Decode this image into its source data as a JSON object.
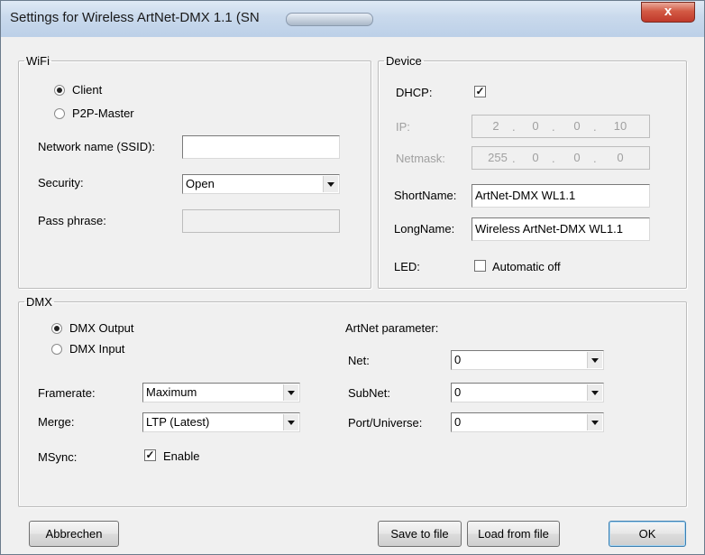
{
  "window": {
    "title": "Settings for Wireless ArtNet-DMX 1.1 (SN",
    "close_glyph": "x"
  },
  "wifi": {
    "legend": "WiFi",
    "mode_options": [
      {
        "label": "Client",
        "selected": true
      },
      {
        "label": "P2P-Master",
        "selected": false
      }
    ],
    "ssid_label": "Network name (SSID):",
    "ssid_value": "",
    "security_label": "Security:",
    "security_value": "Open",
    "passphrase_label": "Pass phrase:",
    "passphrase_value": ""
  },
  "device": {
    "legend": "Device",
    "dhcp_label": "DHCP:",
    "dhcp_checked": true,
    "ip_label": "IP:",
    "ip_octets": [
      "2",
      "0",
      "0",
      "10"
    ],
    "netmask_label": "Netmask:",
    "netmask_octets": [
      "255",
      "0",
      "0",
      "0"
    ],
    "shortname_label": "ShortName:",
    "shortname_value": "ArtNet-DMX WL1.1",
    "longname_label": "LongName:",
    "longname_value": "Wireless ArtNet-DMX WL1.1",
    "led_label": "LED:",
    "led_option_label": "Automatic off",
    "led_checked": false,
    "ip_separator": "."
  },
  "dmx": {
    "legend": "DMX",
    "mode_options": [
      {
        "label": "DMX Output",
        "selected": true
      },
      {
        "label": "DMX Input",
        "selected": false
      }
    ],
    "framerate_label": "Framerate:",
    "framerate_value": "Maximum",
    "merge_label": "Merge:",
    "merge_value": "LTP (Latest)",
    "msync_label": "MSync:",
    "msync_option_label": "Enable",
    "msync_checked": true,
    "artnet_label": "ArtNet parameter:",
    "net_label": "Net:",
    "net_value": "0",
    "subnet_label": "SubNet:",
    "subnet_value": "0",
    "port_label": "Port/Universe:",
    "port_value": "0"
  },
  "buttons": {
    "cancel": "Abbrechen",
    "save": "Save to file",
    "load": "Load from file",
    "ok": "OK"
  },
  "check_glyph": "✓",
  "colors": {
    "dialog_bg": "#f0f0f0",
    "title_gradient_top": "#dfe9f5",
    "close_red": "#c0392b",
    "disabled_text": "#a0a0a0"
  }
}
